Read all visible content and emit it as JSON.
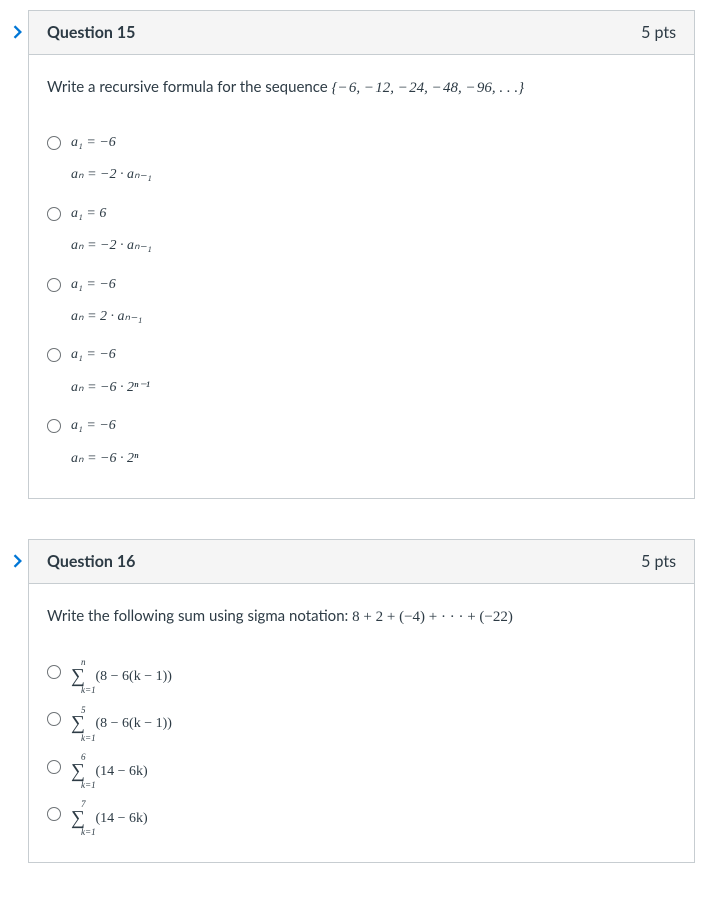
{
  "questions": [
    {
      "title": "Question 15",
      "points": "5 pts",
      "prompt_prefix": "Write a recursive formula for the sequence ",
      "prompt_math": "{− 6, − 12, − 24, − 48, − 96, . . .}",
      "options": [
        {
          "line1": "a₁ = −6",
          "line2": "aₙ = −2 · aₙ₋₁"
        },
        {
          "line1": "a₁ = 6",
          "line2": "aₙ = −2 · aₙ₋₁"
        },
        {
          "line1": "a₁ = −6",
          "line2": "aₙ = 2 · aₙ₋₁"
        },
        {
          "line1": "a₁ = −6",
          "line2": "aₙ = −6 · 2ⁿ⁻¹"
        },
        {
          "line1": "a₁ = −6",
          "line2": "aₙ = −6 · 2ⁿ"
        }
      ]
    },
    {
      "title": "Question 16",
      "points": "5 pts",
      "prompt_prefix": "Write the following sum using sigma notation: ",
      "prompt_math": "8 + 2 + (−4) + · · · + (−22)",
      "sigma_options": [
        {
          "upper": "n",
          "lower": "k=1",
          "body": "(8 − 6(k − 1))"
        },
        {
          "upper": "5",
          "lower": "k=1",
          "body": "(8 − 6(k − 1))"
        },
        {
          "upper": "6",
          "lower": "k=1",
          "body": "(14 − 6k)"
        },
        {
          "upper": "7",
          "lower": "k=1",
          "body": "(14 − 6k)"
        }
      ]
    }
  ]
}
